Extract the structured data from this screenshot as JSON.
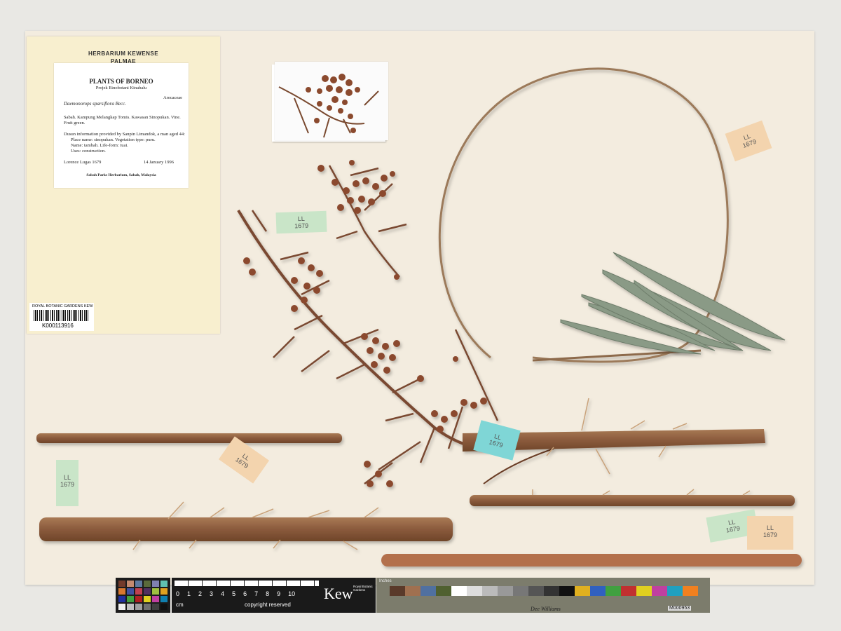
{
  "folder": {
    "line1": "HERBARIUM KEWENSE",
    "line2": "PALMAE"
  },
  "label": {
    "title": "PLANTS OF BORNEO",
    "subtitle": "Projek Etnobotani Kinabalu",
    "family": "Arecaceae",
    "species": "Daemonorops sparsiflora Becc.",
    "locality": "Sabah. Kampung Melangkap Tomis. Kawasan Sinopukan. Vine. Fruit green.",
    "info": "Dusun information provided by Sanpin Limandok, a man aged 44:",
    "place": "Place name: sinopukan. Vegetation type: puru.",
    "name": "Name: tambah. Life-form: tuai.",
    "uses": "Uses: construction.",
    "collector": "Lorence Lugas 1679",
    "date": "14 January 1996",
    "institution": "Sabah Parks Herbarium, Sabah, Malaysia"
  },
  "barcode": {
    "org": "ROYAL BOTANIC GARDENS KEW",
    "number": "K000113916"
  },
  "tags": {
    "green_top": "LL\n1679",
    "tan_right": "LL\n1679",
    "tan_middle": "LL\n1679",
    "blue": "LL\n1679",
    "green_left": "LL\n1679",
    "green_bottom": "LL\n1679",
    "tan_bottom": "LL\n1679"
  },
  "scale": {
    "ruler_numbers": [
      "0",
      "1",
      "2",
      "3",
      "4",
      "5",
      "6",
      "7",
      "8",
      "9",
      "10"
    ],
    "cm": "cm",
    "copyright": "copyright reserved",
    "brand": "Kew",
    "brand_sub": "Royal Botanic Gardens",
    "target_label": "Inches",
    "target_code": "M000953",
    "target_sig": "Dee Williams"
  },
  "colors": {
    "sheet": "#f3ecdf",
    "folder": "#f8efcf",
    "stem": "#8a5a3c",
    "fruit": "#8b4a2e",
    "leaf": "#8a9a86",
    "tag_tan": "#f3d4ae",
    "tag_green": "#c9e5c8",
    "tag_blue": "#7fd6d6"
  }
}
